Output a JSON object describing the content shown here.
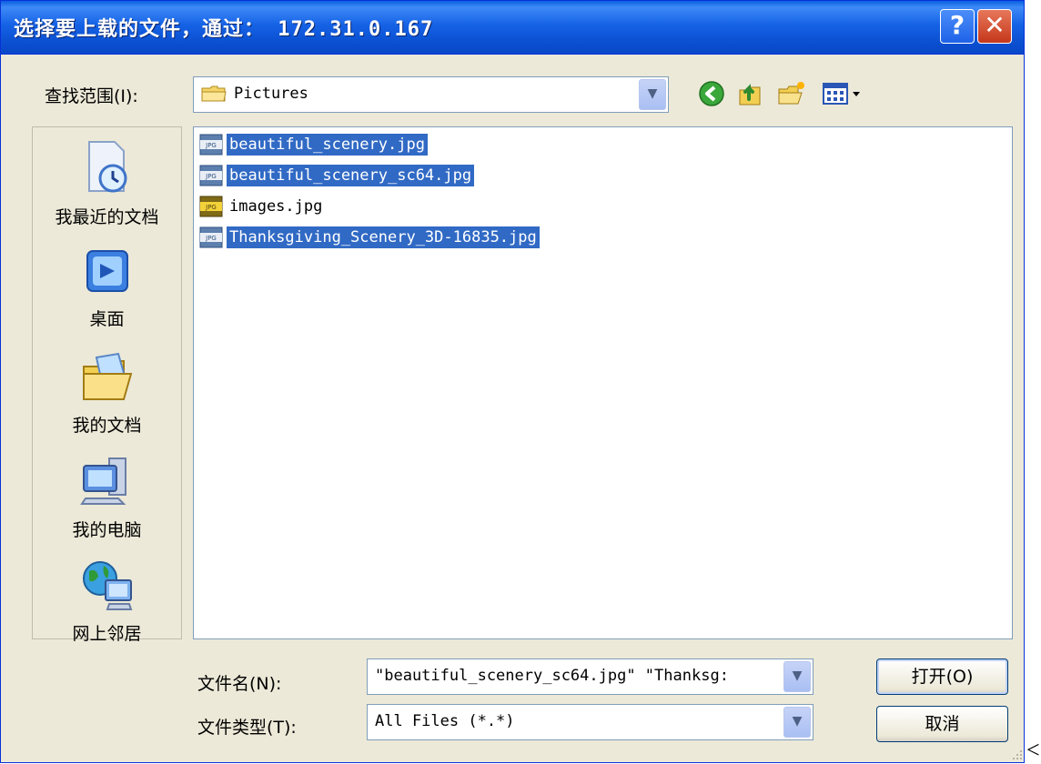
{
  "window": {
    "title": "选择要上载的文件，通过： 172.31.0.167",
    "help_label": "?",
    "close_label": "✕"
  },
  "look_in": {
    "label": "查找范围(I):",
    "value": "Pictures"
  },
  "toolbar": {
    "icons": [
      "back-icon",
      "up-folder-icon",
      "new-folder-icon",
      "view-menu-icon"
    ]
  },
  "places": [
    {
      "label": "我最近的文档",
      "icon": "recent-documents-icon"
    },
    {
      "label": "桌面",
      "icon": "desktop-icon"
    },
    {
      "label": "我的文档",
      "icon": "my-documents-icon"
    },
    {
      "label": "我的电脑",
      "icon": "my-computer-icon"
    },
    {
      "label": "网上邻居",
      "icon": "network-places-icon"
    }
  ],
  "files": [
    {
      "name": "beautiful_scenery.jpg",
      "selected": true
    },
    {
      "name": "beautiful_scenery_sc64.jpg",
      "selected": true
    },
    {
      "name": "images.jpg",
      "selected": false
    },
    {
      "name": "Thanksgiving_Scenery_3D-16835.jpg",
      "selected": true
    }
  ],
  "file_name": {
    "label": "文件名(N):",
    "value": "\"beautiful_scenery_sc64.jpg\" \"Thanksg:"
  },
  "file_type": {
    "label": "文件类型(T):",
    "value": "All Files (*.*)"
  },
  "buttons": {
    "open": "打开(O)",
    "cancel": "取消"
  },
  "stray_text": "<",
  "colors": {
    "title_bar": "#0a5fe0",
    "selection": "#316ac5",
    "dialog_bg": "#ece9d8"
  }
}
